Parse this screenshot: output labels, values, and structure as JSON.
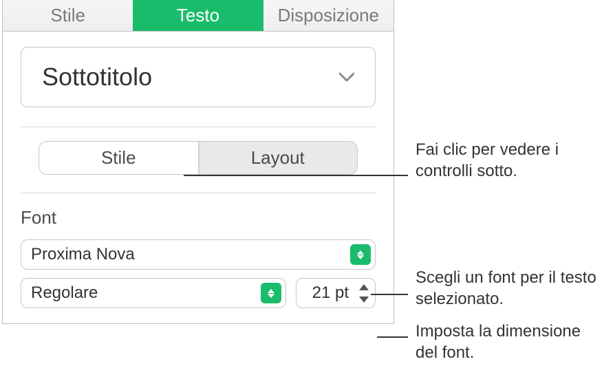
{
  "topTabs": {
    "stile": "Stile",
    "testo": "Testo",
    "disposizione": "Disposizione"
  },
  "paragraphStyle": {
    "label": "Sottotitolo"
  },
  "segmented": {
    "stile": "Stile",
    "layout": "Layout"
  },
  "fontSection": {
    "label": "Font",
    "fontName": "Proxima Nova",
    "fontWeight": "Regolare",
    "fontSize": "21 pt"
  },
  "callouts": {
    "c1": "Fai clic per vedere i controlli sotto.",
    "c2": "Scegli un font per il testo selezionato.",
    "c3": "Imposta la dimensione del font."
  }
}
